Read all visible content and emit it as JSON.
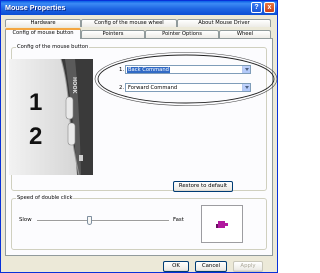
{
  "window": {
    "title": "Mouse Properties",
    "help_label": "?",
    "close_label": "x"
  },
  "tabs": {
    "back_row": [
      "Hardware",
      "Config of the mouse wheel",
      "About Mouse Driver"
    ],
    "front_row": [
      "Config of mouse button",
      "Pointers",
      "Pointer Options",
      "Wheel"
    ],
    "active": "Config of mouse button"
  },
  "button_config": {
    "group_label": "Config of the mouse button",
    "callout_1": "1",
    "callout_2": "2",
    "mouse_brand": "HOOK",
    "assignments": [
      {
        "index": "1.",
        "value": "Back Command",
        "selected": true
      },
      {
        "index": "2.",
        "value": "Forward Command",
        "selected": false
      }
    ],
    "restore_label": "Restore to default"
  },
  "double_click": {
    "group_label": "Speed of double click",
    "slow_label": "Slow",
    "fast_label": "Fast",
    "speed_fraction": 0.4
  },
  "footer": {
    "ok_label": "OK",
    "cancel_label": "Cancel",
    "apply_label": "Apply"
  },
  "colors": {
    "titlebar": "#0a5fe6",
    "selection": "#316ac5",
    "test_icon": "#b0189e",
    "tab_highlight": "#f4a640"
  }
}
